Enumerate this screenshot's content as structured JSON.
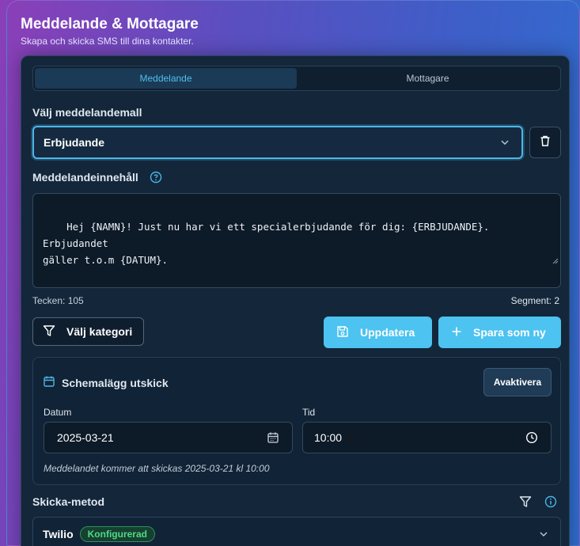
{
  "header": {
    "title": "Meddelande & Mottagare",
    "subtitle": "Skapa och skicka SMS till dina kontakter."
  },
  "tabs": [
    {
      "label": "Meddelande",
      "active": true
    },
    {
      "label": "Mottagare",
      "active": false
    }
  ],
  "template": {
    "label": "Välj meddelandemall",
    "selected": "Erbjudande"
  },
  "content": {
    "label": "Meddelandeinnehåll",
    "text": "Hej {NAMN}! Just nu har vi ett specialerbjudande för dig: {ERBJUDANDE}. Erbjudandet\ngäller t.o.m {DATUM}.",
    "chars_label": "Tecken: 105",
    "segments_label": "Segment: 2"
  },
  "actions": {
    "category_label": "Välj kategori",
    "update_label": "Uppdatera",
    "save_new_label": "Spara som ny"
  },
  "schedule": {
    "title": "Schemalägg utskick",
    "toggle_label": "Avaktivera",
    "date_label": "Datum",
    "date_value": "2025-03-21",
    "time_label": "Tid",
    "time_value": "10:00",
    "note": "Meddelandet kommer att skickas 2025-03-21 kl 10:00"
  },
  "send_method": {
    "label": "Skicka-metod",
    "selected": "Twilio",
    "badge": "Konfigurerad"
  },
  "colors": {
    "accent": "#4cc3f0",
    "card": "#13263a",
    "success": "#4fd98c"
  }
}
